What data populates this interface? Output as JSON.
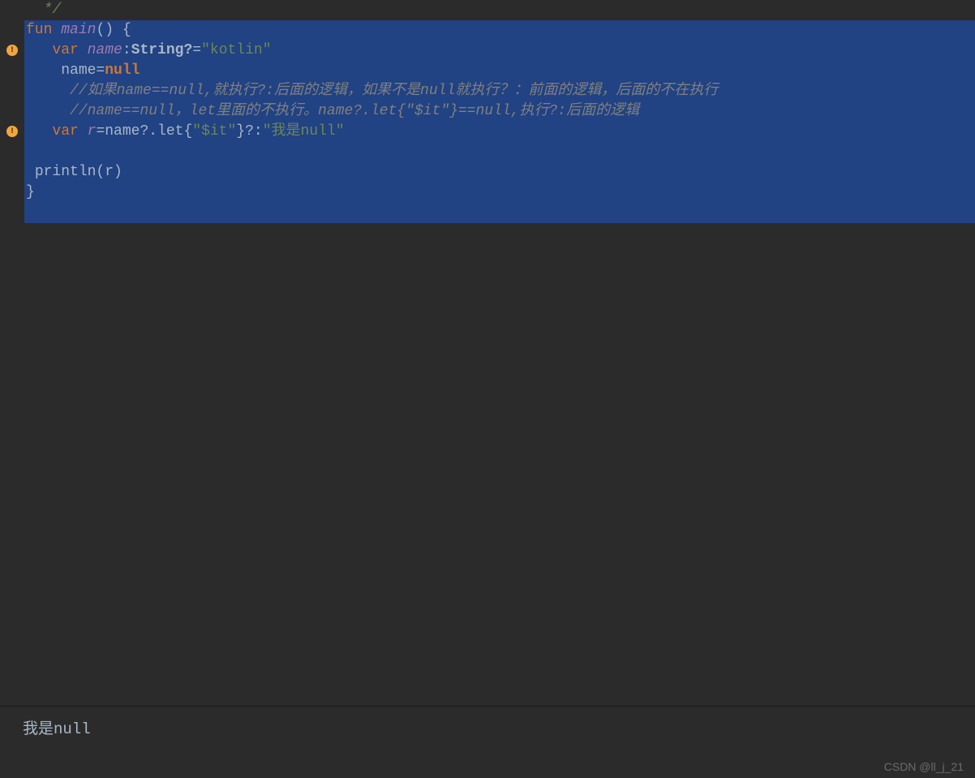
{
  "gutter": {
    "warnings": [
      {
        "lineIndex": 2
      },
      {
        "lineIndex": 6
      }
    ]
  },
  "code": {
    "lines": [
      {
        "selected": false,
        "indent": "  ",
        "tokens": [
          {
            "text": "*/",
            "cls": "comment-green"
          }
        ]
      },
      {
        "selected": true,
        "indent": "",
        "tokens": [
          {
            "text": "fun ",
            "cls": "keyword"
          },
          {
            "text": "main",
            "cls": "funcname"
          },
          {
            "text": "() {",
            "cls": "default"
          }
        ]
      },
      {
        "selected": true,
        "indent": "   ",
        "tokens": [
          {
            "text": "var ",
            "cls": "keyword"
          },
          {
            "text": "name",
            "cls": "varname"
          },
          {
            "text": ":",
            "cls": "default"
          },
          {
            "text": "String?",
            "cls": "type"
          },
          {
            "text": "=",
            "cls": "default"
          },
          {
            "text": "\"kotlin\"",
            "cls": "string"
          }
        ]
      },
      {
        "selected": true,
        "indent": "    ",
        "tokens": [
          {
            "text": "name=",
            "cls": "default"
          },
          {
            "text": "null",
            "cls": "nullkw"
          }
        ]
      },
      {
        "selected": true,
        "indent": "     ",
        "tokens": [
          {
            "text": "//如果name==null,就执行?:后面的逻辑，如果不是null就执行？：前面的逻辑，后面的不在执行",
            "cls": "comment"
          }
        ]
      },
      {
        "selected": true,
        "indent": "     ",
        "tokens": [
          {
            "text": "//name==null，let里面的不执行。name?.let{\"$it\"}==null,执行?:后面的逻辑",
            "cls": "comment"
          }
        ]
      },
      {
        "selected": true,
        "indent": "   ",
        "tokens": [
          {
            "text": "var ",
            "cls": "keyword"
          },
          {
            "text": "r",
            "cls": "varname"
          },
          {
            "text": "=name?.let{",
            "cls": "default"
          },
          {
            "text": "\"",
            "cls": "string"
          },
          {
            "text": "$it",
            "cls": "interp"
          },
          {
            "text": "\"",
            "cls": "string"
          },
          {
            "text": "}?:",
            "cls": "default"
          },
          {
            "text": "\"我是null\"",
            "cls": "string"
          }
        ]
      },
      {
        "selected": true,
        "indent": "",
        "tokens": []
      },
      {
        "selected": true,
        "indent": " ",
        "tokens": [
          {
            "text": "println(r)",
            "cls": "default"
          }
        ]
      },
      {
        "selected": true,
        "indent": "",
        "tokens": [
          {
            "text": "}",
            "cls": "default"
          }
        ]
      },
      {
        "selected": true,
        "indent": "",
        "tokens": []
      }
    ]
  },
  "console": {
    "output": "我是null"
  },
  "watermark": "CSDN @ll_j_21"
}
